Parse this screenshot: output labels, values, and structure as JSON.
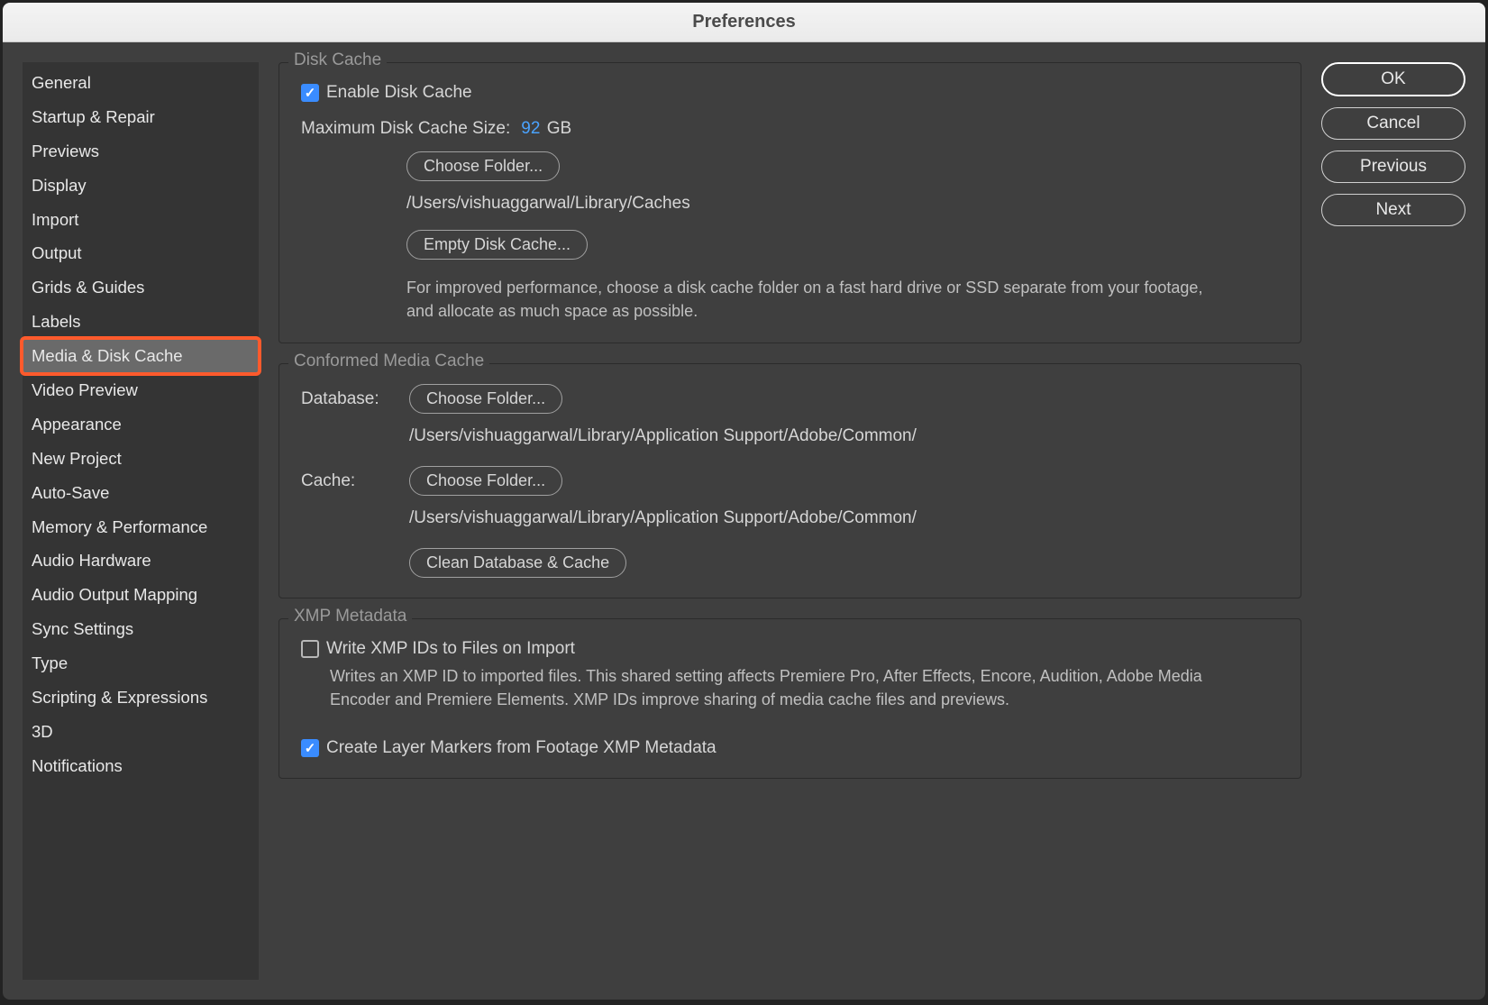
{
  "window": {
    "title": "Preferences"
  },
  "sidebar": {
    "items": [
      "General",
      "Startup & Repair",
      "Previews",
      "Display",
      "Import",
      "Output",
      "Grids & Guides",
      "Labels",
      "Media & Disk Cache",
      "Video Preview",
      "Appearance",
      "New Project",
      "Auto-Save",
      "Memory & Performance",
      "Audio Hardware",
      "Audio Output Mapping",
      "Sync Settings",
      "Type",
      "Scripting & Expressions",
      "3D",
      "Notifications"
    ],
    "selected_index": 8
  },
  "disk_cache": {
    "legend": "Disk Cache",
    "enable_label": "Enable Disk Cache",
    "max_label": "Maximum Disk Cache Size:",
    "max_value": "92",
    "max_unit": "GB",
    "choose_folder": "Choose Folder...",
    "folder_path": "/Users/vishuaggarwal/Library/Caches",
    "empty_button": "Empty Disk Cache...",
    "description": "For improved performance, choose a disk cache folder on a fast hard drive or SSD separate from your footage, and allocate as much space as possible."
  },
  "conformed": {
    "legend": "Conformed Media Cache",
    "db_label": "Database:",
    "db_choose": "Choose Folder...",
    "db_path": "/Users/vishuaggarwal/Library/Application Support/Adobe/Common/",
    "cache_label": "Cache:",
    "cache_choose": "Choose Folder...",
    "cache_path": "/Users/vishuaggarwal/Library/Application Support/Adobe/Common/",
    "clean_button": "Clean Database & Cache"
  },
  "xmp": {
    "legend": "XMP Metadata",
    "write_label": "Write XMP IDs to Files on Import",
    "write_desc": "Writes an XMP ID to imported files. This shared setting affects Premiere Pro, After Effects, Encore, Audition, Adobe Media Encoder and Premiere Elements. XMP IDs improve sharing of media cache files and previews.",
    "create_markers_label": "Create Layer Markers from Footage XMP Metadata"
  },
  "buttons": {
    "ok": "OK",
    "cancel": "Cancel",
    "previous": "Previous",
    "next": "Next"
  }
}
